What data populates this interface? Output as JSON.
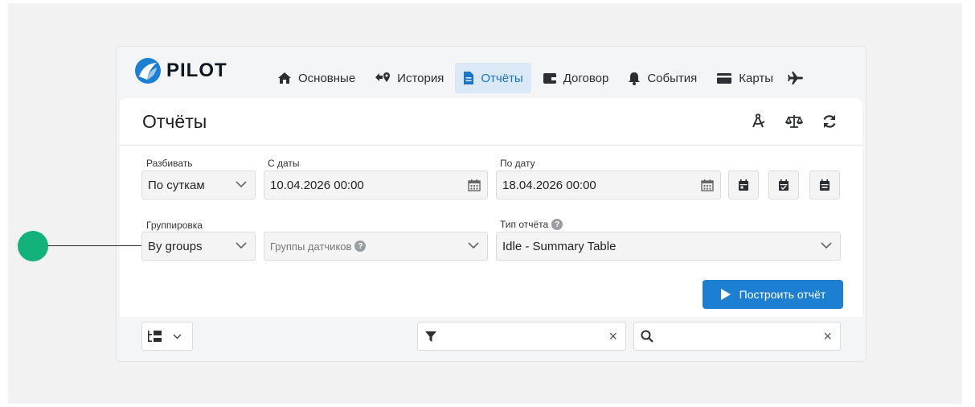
{
  "brand": {
    "logo_text": "PILOT"
  },
  "nav": {
    "items": [
      {
        "label": "Основные",
        "icon": "home-icon"
      },
      {
        "label": "История",
        "icon": "history-icon"
      },
      {
        "label": "Отчёты",
        "icon": "file-icon",
        "active": true
      },
      {
        "label": "Договор",
        "icon": "wallet-icon"
      },
      {
        "label": "События",
        "icon": "bell-icon"
      },
      {
        "label": "Карты",
        "icon": "card-icon"
      }
    ],
    "more_icon": "plane-icon"
  },
  "page": {
    "title": "Отчёты",
    "header_icons": [
      "compass-icon",
      "balance-scale-icon",
      "refresh-icon"
    ]
  },
  "form": {
    "split_label": "Разбивать",
    "split_value": "По суткам",
    "from_label": "С даты",
    "from_value": "10.04.2026 00:00",
    "to_label": "По дату",
    "to_value": "18.04.2026 00:00",
    "grouping_label": "Группировка",
    "grouping_value": "By groups",
    "sensor_groups_placeholder": "Группы датчиков",
    "report_type_label": "Тип отчёта",
    "report_type_value": "Idle - Summary Table",
    "build_label": "Построить отчёт"
  },
  "toolbar": {
    "filter_value": "",
    "search_value": ""
  },
  "colors": {
    "accent": "#1d7fd1",
    "annotation": "#12b27a"
  }
}
